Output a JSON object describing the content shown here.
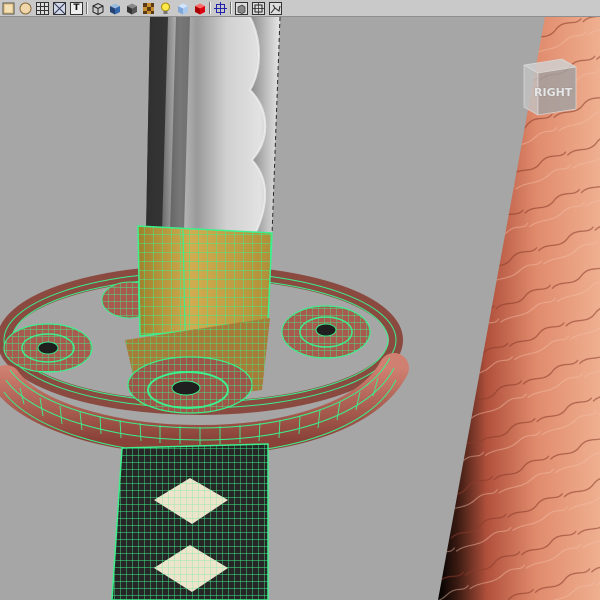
{
  "toolbar": {
    "tools": [
      {
        "name": "light-bulb-icon"
      },
      {
        "name": "sphere-icon"
      },
      {
        "name": "checker-icon"
      },
      {
        "name": "uv-icon"
      },
      {
        "name": "text-tool-icon",
        "glyph": "T"
      },
      {
        "name": "wire-cube-icon"
      },
      {
        "name": "shaded-cube-icon"
      },
      {
        "name": "dark-cube-icon"
      },
      {
        "name": "texture-cube-icon"
      },
      {
        "name": "lightbulb-icon"
      },
      {
        "name": "blue-cube-icon"
      },
      {
        "name": "red-cube-icon"
      },
      {
        "name": "resolution-gate-icon"
      },
      {
        "name": "gray-cube-icon"
      },
      {
        "name": "film-gate-icon"
      },
      {
        "name": "isolate-icon"
      }
    ]
  },
  "viewcube": {
    "label": "RIGHT"
  },
  "scene": {
    "colors": {
      "background": "#a6a6a6",
      "wireframe": "#3cf08c",
      "guard": "#c06a5f",
      "collar": "#c9a84a",
      "blade_light": "#c8c8c8",
      "blade_dark": "#555555",
      "wrap": "#2b2b2b",
      "diamond": "#efe7d2",
      "scabbard": "#d98a6a"
    }
  }
}
